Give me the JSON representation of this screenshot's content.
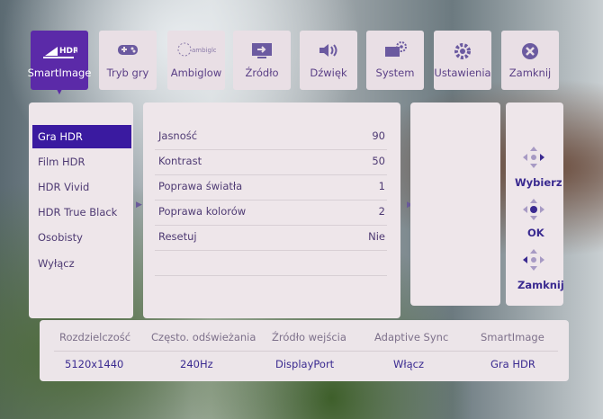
{
  "tabs": [
    {
      "label": "SmartImage",
      "icon": "hdr-icon",
      "badge": "HDR"
    },
    {
      "label": "Tryb gry",
      "icon": "gamepad-icon"
    },
    {
      "label": "Ambiglow",
      "icon": "ambiglow-icon",
      "badge": "ambiglow"
    },
    {
      "label": "Źródło",
      "icon": "input-source-icon"
    },
    {
      "label": "Dźwięk",
      "icon": "speaker-icon"
    },
    {
      "label": "System",
      "icon": "system-icon"
    },
    {
      "label": "Ustawienia",
      "icon": "gear-icon"
    },
    {
      "label": "Zamknij",
      "icon": "close-icon"
    }
  ],
  "modes": [
    "Gra HDR",
    "Film HDR",
    "HDR Vivid",
    "HDR True Black",
    "Osobisty",
    "Wyłącz"
  ],
  "settings": [
    {
      "label": "Jasność",
      "value": "90"
    },
    {
      "label": "Kontrast",
      "value": "50"
    },
    {
      "label": "Poprawa światła",
      "value": "1"
    },
    {
      "label": "Poprawa kolorów",
      "value": "2"
    },
    {
      "label": "Resetuj",
      "value": "Nie"
    }
  ],
  "nav": {
    "select": "Wybierz",
    "ok": "OK",
    "close": "Zamknij"
  },
  "status": {
    "labels": [
      "Rozdzielczość",
      "Często. odświeżania",
      "Źródło wejścia",
      "Adaptive Sync",
      "SmartImage"
    ],
    "values": [
      "5120x1440",
      "240Hz",
      "DisplayPort",
      "Włącz",
      "Gra HDR"
    ]
  },
  "colors": {
    "accent": "#5b2aa8",
    "selected": "#3a1aa0",
    "panel": "#eee6ea",
    "text": "#4e3a73"
  }
}
